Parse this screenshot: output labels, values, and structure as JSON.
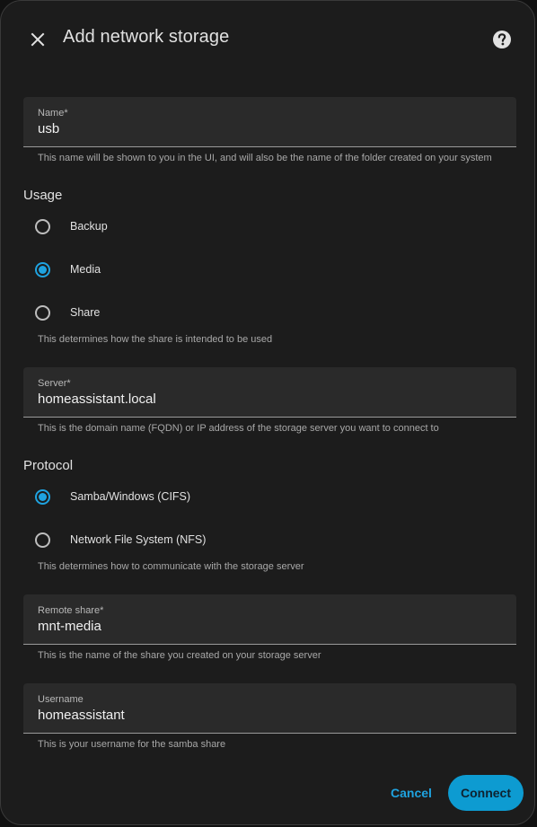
{
  "dialog": {
    "title": "Add network storage",
    "close_icon": "close-icon",
    "help_icon": "help-circle-icon"
  },
  "name_field": {
    "label": "Name*",
    "value": "usb",
    "helper": "This name will be shown to you in the UI, and will also be the name of the folder created on your system"
  },
  "usage": {
    "label": "Usage",
    "options": [
      {
        "label": "Backup",
        "checked": false
      },
      {
        "label": "Media",
        "checked": true
      },
      {
        "label": "Share",
        "checked": false
      }
    ],
    "helper": "This determines how the share is intended to be used"
  },
  "server_field": {
    "label": "Server*",
    "value": "homeassistant.local",
    "helper": "This is the domain name (FQDN) or IP address of the storage server you want to connect to"
  },
  "protocol": {
    "label": "Protocol",
    "options": [
      {
        "label": "Samba/Windows (CIFS)",
        "checked": true
      },
      {
        "label": "Network File System (NFS)",
        "checked": false
      }
    ],
    "helper": "This determines how to communicate with the storage server"
  },
  "remote_share_field": {
    "label": "Remote share*",
    "value": "mnt-media",
    "helper": "This is the name of the share you created on your storage server"
  },
  "username_field": {
    "label": "Username",
    "value": "homeassistant",
    "helper": "This is your username for the samba share"
  },
  "actions": {
    "cancel_label": "Cancel",
    "connect_label": "Connect"
  },
  "colors": {
    "accent": "#1fa3e0",
    "primary_button": "#0d9bd1",
    "dialog_bg": "#1c1c1c",
    "field_bg": "#2a2a2a"
  }
}
